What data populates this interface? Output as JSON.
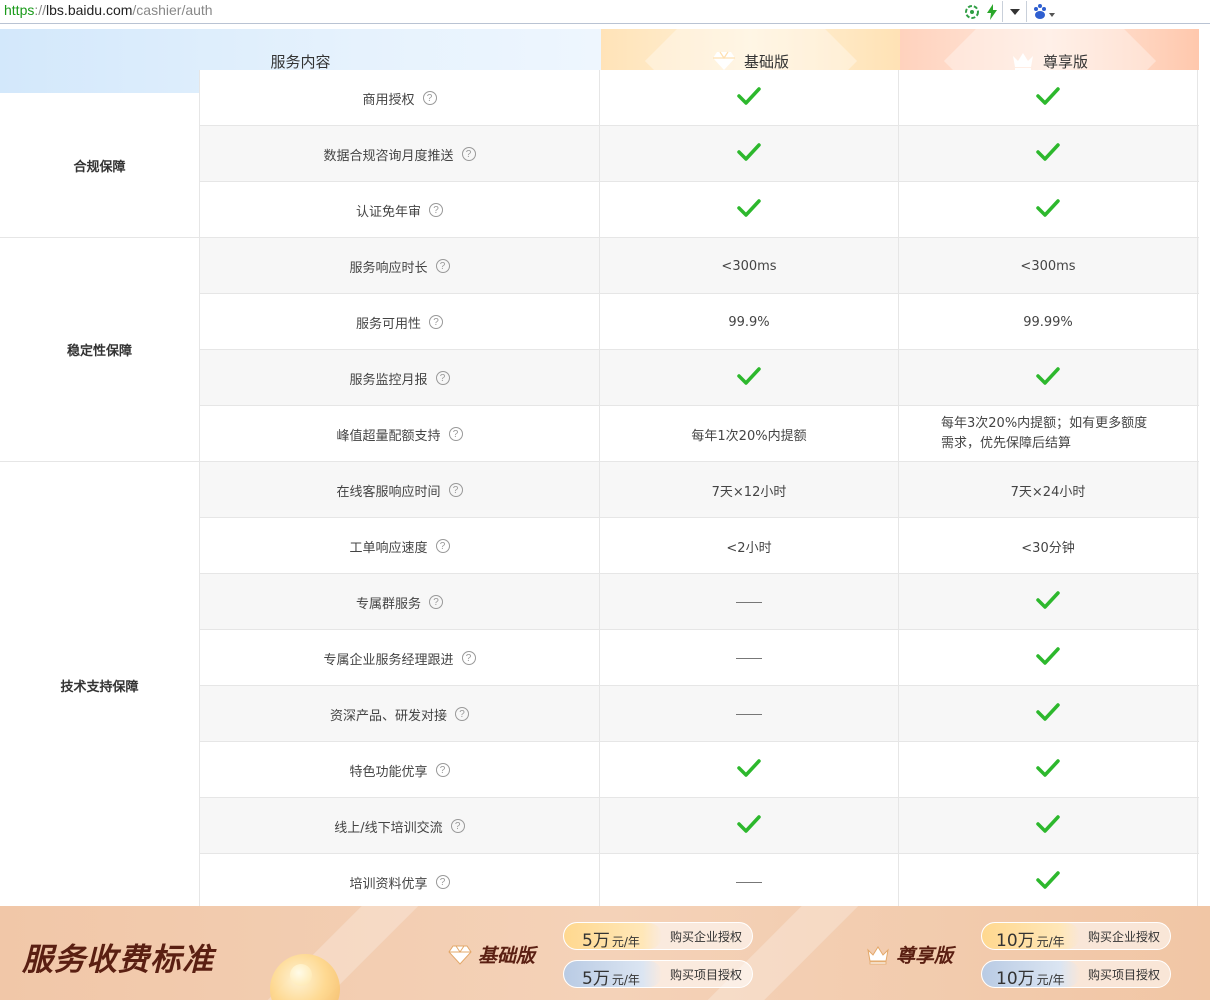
{
  "address_bar": {
    "scheme": "https",
    "host": "lbs.baidu.com",
    "path": "/cashier/auth",
    "icons": [
      "refresh-icon",
      "lightning-icon",
      "dropdown-icon",
      "baidu-paw-icon"
    ]
  },
  "header": {
    "service_label": "服务内容",
    "basic_label": "基础版",
    "vip_label": "尊享版"
  },
  "groups": [
    {
      "name": "合规保障"
    },
    {
      "name": "稳定性保障"
    },
    {
      "name": "技术支持保障"
    }
  ],
  "rows": [
    {
      "name": "商用授权",
      "basic": "check",
      "vip": "check"
    },
    {
      "name": "数据合规咨询月度推送",
      "basic": "check",
      "vip": "check"
    },
    {
      "name": "认证免年审",
      "basic": "check",
      "vip": "check"
    },
    {
      "name": "服务响应时长",
      "basic": "<300ms",
      "vip": "<300ms"
    },
    {
      "name": "服务可用性",
      "basic": "99.9%",
      "vip": "99.99%"
    },
    {
      "name": "服务监控月报",
      "basic": "check",
      "vip": "check"
    },
    {
      "name": "峰值超量配额支持",
      "basic": "每年1次20%内提额",
      "vip": "每年3次20%内提额；如有更多额度需求，优先保障后结算"
    },
    {
      "name": "在线客服响应时间",
      "basic": "7天×12小时",
      "vip": "7天×24小时"
    },
    {
      "name": "工单响应速度",
      "basic": "<2小时",
      "vip": "<30分钟"
    },
    {
      "name": "专属群服务",
      "basic": "dash",
      "vip": "check"
    },
    {
      "name": "专属企业服务经理跟进",
      "basic": "dash",
      "vip": "check"
    },
    {
      "name": "资深产品、研发对接",
      "basic": "dash",
      "vip": "check"
    },
    {
      "name": "特色功能优享",
      "basic": "check",
      "vip": "check"
    },
    {
      "name": "线上/线下培训交流",
      "basic": "check",
      "vip": "check"
    },
    {
      "name": "培训资料优享",
      "basic": "dash",
      "vip": "check"
    }
  ],
  "help_glyph": "?",
  "banner": {
    "title": "服务收费标准",
    "basic": {
      "label": "基础版",
      "enterprise_price": "5万",
      "project_price": "5万",
      "unit": "元/年",
      "enterprise_button": "购买企业授权",
      "project_button": "购买项目授权"
    },
    "vip": {
      "label": "尊享版",
      "enterprise_price": "10万",
      "project_price": "10万",
      "unit": "元/年",
      "enterprise_button": "购买企业授权",
      "project_button": "购买项目授权"
    }
  },
  "colors": {
    "check": "#2db82d",
    "banner_text": "#5a1f12"
  }
}
